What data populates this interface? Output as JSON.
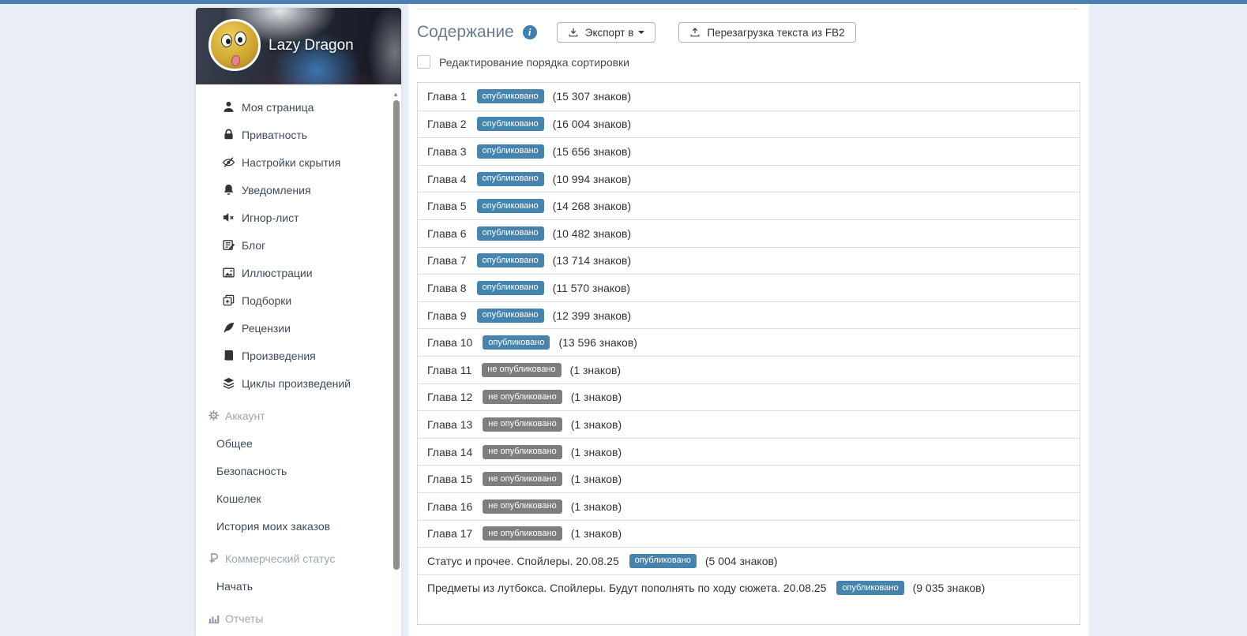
{
  "page": {
    "accent_bar_color": "#4d80b2",
    "background_color": "#e9eef6",
    "badge_published_color": "#4684ae",
    "badge_unpublished_color": "#7e7e7e"
  },
  "profile": {
    "name": "Lazy Dragon"
  },
  "sidebar": {
    "scroll_up_glyph": "▲",
    "main_items": [
      {
        "icon": "user-icon",
        "label": "Моя страница"
      },
      {
        "icon": "lock-icon",
        "label": "Приватность"
      },
      {
        "icon": "eye-slash-icon",
        "label": "Настройки скрытия"
      },
      {
        "icon": "bell-icon",
        "label": "Уведомления"
      },
      {
        "icon": "mute-icon",
        "label": "Игнор-лист"
      },
      {
        "icon": "blog-icon",
        "label": "Блог"
      },
      {
        "icon": "image-icon",
        "label": "Иллюстрации"
      },
      {
        "icon": "collections-icon",
        "label": "Подборки"
      },
      {
        "icon": "feather-icon",
        "label": "Рецензии"
      },
      {
        "icon": "book-icon",
        "label": "Произведения"
      },
      {
        "icon": "stack-icon",
        "label": "Циклы произведений"
      }
    ],
    "sections": [
      {
        "icon": "gears-icon",
        "label": "Аккаунт",
        "items": [
          "Общее",
          "Безопасность",
          "Кошелек",
          "История моих заказов"
        ]
      },
      {
        "icon": "ruble-icon",
        "label": "Коммерческий статус",
        "items": [
          "Начать"
        ]
      },
      {
        "icon": "chart-icon",
        "label": "Отчеты",
        "items": []
      }
    ]
  },
  "content": {
    "title": "Содержание",
    "info_icon_glyph": "i",
    "export_button_label": "Экспорт в",
    "reload_button_label": "Перезагрузка текста из FB2",
    "sort_checkbox_label": "Редактирование порядка сортировки",
    "sort_checkbox_checked": false,
    "chapters": [
      {
        "title": "Глава 1",
        "status": "опубликовано",
        "chars": "(15 307 знаков)"
      },
      {
        "title": "Глава 2",
        "status": "опубликовано",
        "chars": "(16 004 знаков)"
      },
      {
        "title": "Глава 3",
        "status": "опубликовано",
        "chars": "(15 656 знаков)"
      },
      {
        "title": "Глава 4",
        "status": "опубликовано",
        "chars": "(10 994 знаков)"
      },
      {
        "title": "Глава 5",
        "status": "опубликовано",
        "chars": "(14 268 знаков)"
      },
      {
        "title": "Глава 6",
        "status": "опубликовано",
        "chars": "(10 482 знаков)"
      },
      {
        "title": "Глава 7",
        "status": "опубликовано",
        "chars": "(13 714 знаков)"
      },
      {
        "title": "Глава 8",
        "status": "опубликовано",
        "chars": "(11 570 знаков)"
      },
      {
        "title": "Глава 9",
        "status": "опубликовано",
        "chars": "(12 399 знаков)"
      },
      {
        "title": "Глава 10",
        "status": "опубликовано",
        "chars": "(13 596 знаков)"
      },
      {
        "title": "Глава 11",
        "status": "не опубликовано",
        "unpublished": true,
        "chars": "(1 знаков)"
      },
      {
        "title": "Глава 12",
        "status": "не опубликовано",
        "unpublished": true,
        "chars": "(1 знаков)"
      },
      {
        "title": "Глава 13",
        "status": "не опубликовано",
        "unpublished": true,
        "chars": "(1 знаков)"
      },
      {
        "title": "Глава 14",
        "status": "не опубликовано",
        "unpublished": true,
        "chars": "(1 знаков)"
      },
      {
        "title": "Глава 15",
        "status": "не опубликовано",
        "unpublished": true,
        "chars": "(1 знаков)"
      },
      {
        "title": "Глава 16",
        "status": "не опубликовано",
        "unpublished": true,
        "chars": "(1 знаков)"
      },
      {
        "title": "Глава 17",
        "status": "не опубликовано",
        "unpublished": true,
        "chars": "(1 знаков)"
      },
      {
        "title": "Статус и прочее. Спойлеры. 20.08.25",
        "status": "опубликовано",
        "chars": "(5 004 знаков)"
      },
      {
        "title": "Предметы из лутбокса. Спойлеры. Будут пополнять по ходу сюжета. 20.08.25",
        "status": "опубликовано",
        "chars": "(9 035 знаков)"
      }
    ]
  }
}
